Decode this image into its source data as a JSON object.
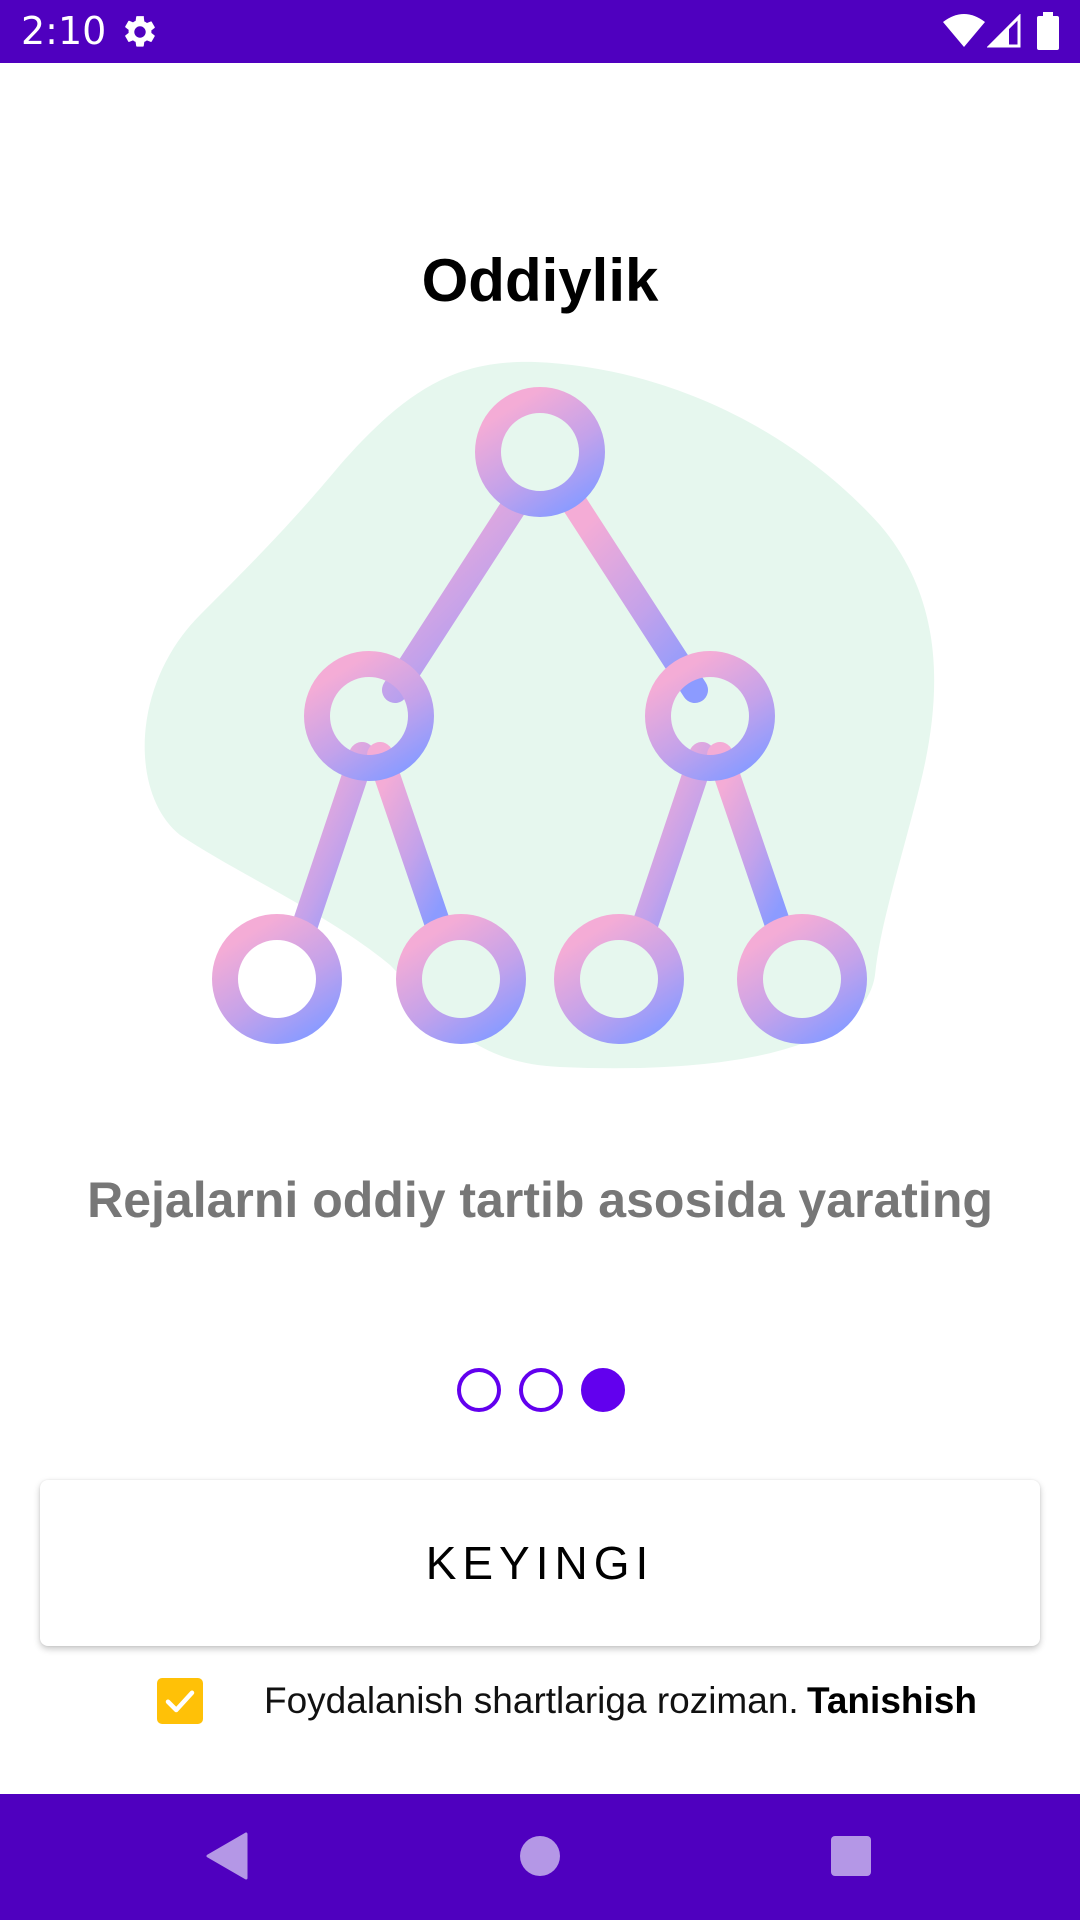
{
  "status_bar": {
    "time": "2:10",
    "icons": [
      "gear-icon",
      "wifi-icon",
      "signal-icon",
      "battery-icon"
    ],
    "background": "#4f00bf"
  },
  "onboarding": {
    "title": "Oddiylik",
    "subtitle": "Rejalarni oddiy tartib asosida yarating",
    "illustration_icon": "hierarchy-tree-icon",
    "page_count": 3,
    "active_page": 3
  },
  "actions": {
    "next_label": "KEYINGI"
  },
  "terms": {
    "checked": true,
    "text": "Foydalanish shartlariga roziman.",
    "link_label": "Tanishish"
  },
  "nav_bar": {
    "icons": [
      "back-icon",
      "home-icon",
      "recents-icon"
    ]
  },
  "colors": {
    "accent": "#6200ee",
    "system_bars": "#4f00bf",
    "checkbox": "#ffc107",
    "blob": "#e6f7ee",
    "gradient_start": "#f4acd6",
    "gradient_end": "#8c9bff"
  }
}
